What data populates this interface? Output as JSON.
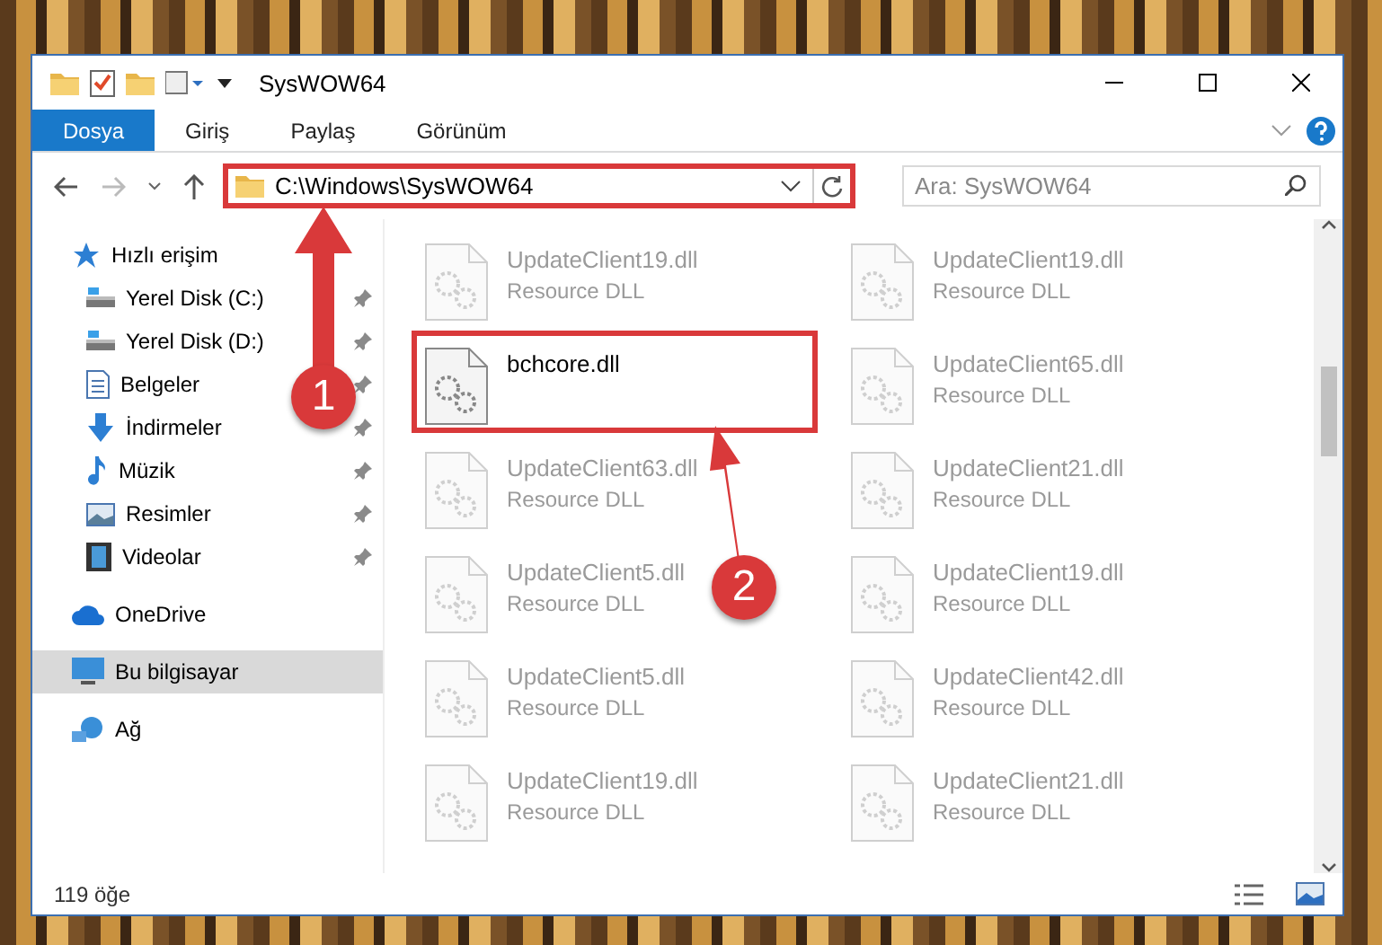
{
  "window": {
    "title": "SysWOW64"
  },
  "ribbon": {
    "tabs": [
      {
        "label": "Dosya",
        "selected": true
      },
      {
        "label": "Giriş",
        "selected": false
      },
      {
        "label": "Paylaş",
        "selected": false
      },
      {
        "label": "Görünüm",
        "selected": false
      }
    ]
  },
  "address_bar": {
    "value": "C:\\Windows\\SysWOW64",
    "highlighted": true
  },
  "search": {
    "placeholder": "Ara: SysWOW64"
  },
  "sidebar": {
    "items": [
      {
        "label": "Hızlı erişim",
        "selected": false,
        "children": [
          {
            "label": "Yerel Disk (C:)",
            "pinned": true
          },
          {
            "label": "Yerel Disk (D:)",
            "pinned": true
          },
          {
            "label": "Belgeler",
            "pinned": true
          },
          {
            "label": "İndirmeler",
            "pinned": true
          },
          {
            "label": "Müzik",
            "pinned": true
          },
          {
            "label": "Resimler",
            "pinned": true
          },
          {
            "label": "Videolar",
            "pinned": true
          }
        ]
      },
      {
        "label": "OneDrive",
        "selected": false
      },
      {
        "label": "Bu bilgisayar",
        "selected": true
      },
      {
        "label": "Ağ",
        "selected": false
      }
    ]
  },
  "files": [
    {
      "name": "UpdateClient19.dll",
      "type": "Resource DLL",
      "blurred": true,
      "highlighted": false
    },
    {
      "name": "UpdateClient19.dll",
      "type": "Resource DLL",
      "blurred": true,
      "highlighted": false
    },
    {
      "name": "bchcore.dll",
      "blurred": false,
      "highlighted": true
    },
    {
      "name": "UpdateClient65.dll",
      "type": "Resource DLL",
      "blurred": true,
      "highlighted": false
    },
    {
      "name": "UpdateClient63.dll",
      "type": "Resource DLL",
      "blurred": true,
      "highlighted": false
    },
    {
      "name": "UpdateClient21.dll",
      "type": "Resource DLL",
      "blurred": true,
      "highlighted": false
    },
    {
      "name": "UpdateClient5.dll",
      "type": "Resource DLL",
      "blurred": true,
      "highlighted": false
    },
    {
      "name": "UpdateClient19.dll",
      "type": "Resource DLL",
      "blurred": true,
      "highlighted": false
    },
    {
      "name": "UpdateClient5.dll",
      "type": "Resource DLL",
      "blurred": true,
      "highlighted": false
    },
    {
      "name": "UpdateClient42.dll",
      "type": "Resource DLL",
      "blurred": true,
      "highlighted": false
    },
    {
      "name": "UpdateClient19.dll",
      "type": "Resource DLL",
      "blurred": true,
      "highlighted": false
    },
    {
      "name": "UpdateClient21.dll",
      "type": "Resource DLL",
      "blurred": true,
      "highlighted": false
    }
  ],
  "status_bar": {
    "count": "119 öğe"
  },
  "annotations": [
    {
      "label": "1"
    },
    {
      "label": "2"
    }
  ]
}
